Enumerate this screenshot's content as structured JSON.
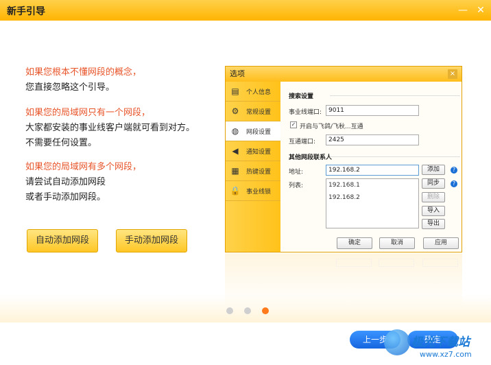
{
  "window": {
    "title": "新手引导",
    "minimize": "—",
    "close": "✕"
  },
  "guide": {
    "p1": [
      "如果您根本不懂网段的概念，",
      "您直接忽略这个引导。"
    ],
    "p2": [
      "如果您的局域网只有一个网段，",
      "大家都安装的事业线客户端就可看到对方。",
      "不需要任何设置。"
    ],
    "p3": [
      "如果您的局域网有多个网段，",
      "请尝试自动添加网段",
      "或者手动添加网段。"
    ]
  },
  "buttons": {
    "auto": "自动添加网段",
    "manual": "手动添加网段",
    "prev": "上一步",
    "ok": "确定"
  },
  "dialog": {
    "title": "选项",
    "close": "×",
    "sidebar": [
      {
        "label": "个人信息",
        "icon": "id-card-icon"
      },
      {
        "label": "常规设置",
        "icon": "gear-icon"
      },
      {
        "label": "网段设置",
        "icon": "globe-icon",
        "active": true
      },
      {
        "label": "通知设置",
        "icon": "speaker-icon"
      },
      {
        "label": "热键设置",
        "icon": "keyboard-icon"
      },
      {
        "label": "事业线锁",
        "icon": "lock-icon"
      }
    ],
    "search_section": "搜索设置",
    "port_label": "事业线端口:",
    "port_value": "9011",
    "interop_check": "开启与飞鸽/飞秋...互通",
    "interop_port_label": "互通端口:",
    "interop_port_value": "2425",
    "contacts_section": "其他网段联系人",
    "addr_label": "地址:",
    "addr_value": "192.168.2",
    "list_label": "列表:",
    "list_items": [
      "192.168.1",
      "192.168.2"
    ],
    "add_btn": "添加",
    "sync_btn": "同步",
    "delete_btn": "删除",
    "import_btn": "导入",
    "export_btn": "导出",
    "ok": "确定",
    "cancel": "取消",
    "apply": "应用",
    "help": "?"
  },
  "pagination": {
    "total": 3,
    "current": 3
  },
  "watermark": {
    "name": "极光下载站",
    "url": "www.xz7.com"
  }
}
